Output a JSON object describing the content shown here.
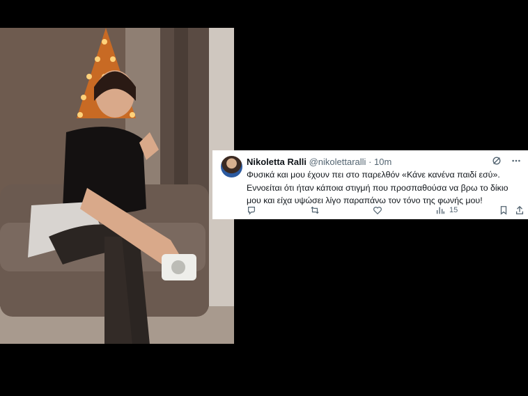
{
  "photo": {
    "description_icon": "woman-photo"
  },
  "tweet": {
    "display_name": "Nikoletta Ralli",
    "handle": "@nikolettaralli",
    "separator": "·",
    "time": "10m",
    "text": "Φυσικά και μου έχουν πει στο παρελθόν «Κάνε κανένα παιδί εσύ». Εννοείται ότι ήταν κάποια στιγμή που προσπαθούσα να βρω το δίκιο μου και είχα υψώσει λίγο παραπάνω τον τόνο της φωνής μου!",
    "views_count": "15",
    "colors": {
      "text": "#0f1419",
      "secondary": "#536471"
    }
  }
}
